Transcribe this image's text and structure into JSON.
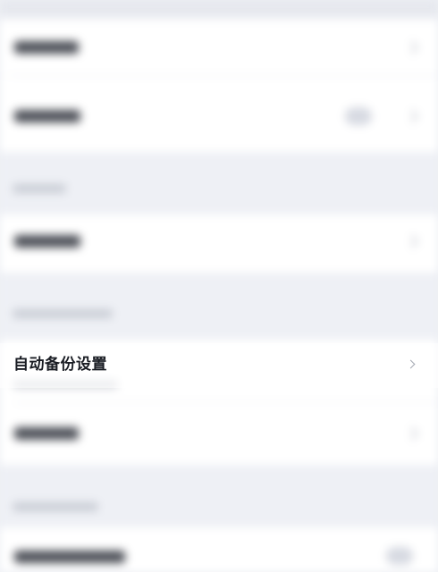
{
  "settings": {
    "auto_backup": {
      "label": "自动备份设置",
      "chevron_icon": "chevron-right-icon"
    }
  },
  "colors": {
    "page_background": "#eef0f5",
    "row_background": "#ffffff",
    "label_text": "#1a1d24",
    "chevron": "#a4a8b2"
  }
}
